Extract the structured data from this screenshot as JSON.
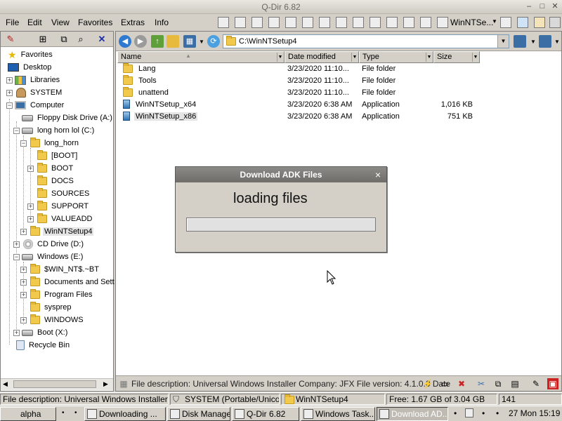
{
  "window": {
    "title": "Q-Dir 6.82"
  },
  "menu": [
    "File",
    "Edit",
    "View",
    "Favorites",
    "Extras",
    "Info"
  ],
  "toolbar": {
    "active_window_label": "WinNTSe..."
  },
  "tree": {
    "items": [
      {
        "label": "Favorites"
      },
      {
        "label": "Desktop"
      },
      {
        "label": "Libraries"
      },
      {
        "label": "SYSTEM"
      },
      {
        "label": "Computer"
      },
      {
        "label": "Floppy Disk Drive (A:)"
      },
      {
        "label": "long horn lol (C:)"
      },
      {
        "label": "long_horn"
      },
      {
        "label": "[BOOT]"
      },
      {
        "label": "BOOT"
      },
      {
        "label": "DOCS"
      },
      {
        "label": "SOURCES"
      },
      {
        "label": "SUPPORT"
      },
      {
        "label": "VALUEADD"
      },
      {
        "label": "WinNTSetup4"
      },
      {
        "label": "CD Drive (D:)"
      },
      {
        "label": "Windows (E:)"
      },
      {
        "label": "$WIN_NT$.~BT"
      },
      {
        "label": "Documents and Sett"
      },
      {
        "label": "Program Files"
      },
      {
        "label": "sysprep"
      },
      {
        "label": "WINDOWS"
      },
      {
        "label": "Boot (X:)"
      },
      {
        "label": "Recycle Bin"
      }
    ]
  },
  "address": {
    "path": "C:\\WinNTSetup4"
  },
  "columns": {
    "name": "Name",
    "date": "Date modified",
    "type": "Type",
    "size": "Size"
  },
  "files": [
    {
      "name": "Lang",
      "date": "3/23/2020 11:10...",
      "type": "File folder",
      "size": ""
    },
    {
      "name": "Tools",
      "date": "3/23/2020 11:10...",
      "type": "File folder",
      "size": ""
    },
    {
      "name": "unattend",
      "date": "3/23/2020 11:10...",
      "type": "File folder",
      "size": ""
    },
    {
      "name": "WinNTSetup_x64",
      "date": "3/23/2020 6:38 AM",
      "type": "Application",
      "size": "1,016 KB"
    },
    {
      "name": "WinNTSetup_x86",
      "date": "3/23/2020 6:38 AM",
      "type": "Application",
      "size": "751 KB"
    }
  ],
  "info_bar": {
    "text": "File description: Universal Windows Installer Company: JFX File version: 4.1.0.0 Date"
  },
  "status_bar": {
    "description": "File description: Universal Windows Installer Comp",
    "encoding": "SYSTEM (Portable/Unicode)",
    "folder": "WinNTSetup4",
    "free": "Free: 1.67 GB of 3.04 GB",
    "count": "141"
  },
  "dialog": {
    "title": "Download ADK Files",
    "close_glyph": "×",
    "message": "loading files",
    "progress": 0
  },
  "taskbar": {
    "start_label": "alpha",
    "tasks": [
      "Downloading ...",
      "Disk Managem...",
      "Q-Dir 6.82",
      "Windows Task...",
      "Download AD..."
    ],
    "clock": "27 Mon 15:19"
  }
}
